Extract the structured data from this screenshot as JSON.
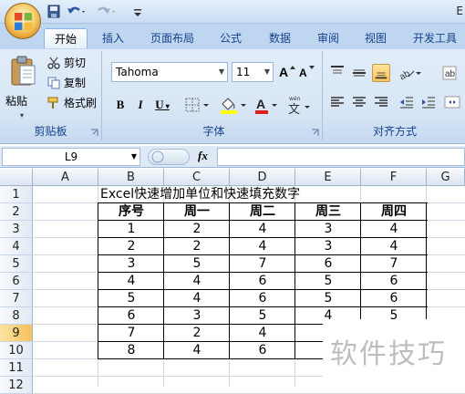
{
  "window": {
    "title_fragment": "E"
  },
  "tabs": [
    "开始",
    "插入",
    "页面布局",
    "公式",
    "数据",
    "审阅",
    "视图",
    "开发工具"
  ],
  "clipboard": {
    "paste": "粘贴",
    "cut": "剪切",
    "copy": "复制",
    "format_painter": "格式刷",
    "group_label": "剪贴板"
  },
  "font": {
    "name": "Tahoma",
    "size": "11",
    "group_label": "字体",
    "phonetic": "文"
  },
  "alignment": {
    "group_label": "对齐方式"
  },
  "formula_bar": {
    "name_box": "L9",
    "fx": "fx",
    "value": ""
  },
  "columns": [
    "A",
    "B",
    "C",
    "D",
    "E",
    "F",
    "G"
  ],
  "rows": [
    "1",
    "2",
    "3",
    "4",
    "5",
    "6",
    "7",
    "8",
    "9",
    "10",
    "11",
    "12"
  ],
  "selected_row": "9",
  "sheet": {
    "title": "Excel快速增加单位和快速填充数字",
    "headers": [
      "序号",
      "周一",
      "周二",
      "周三",
      "周四"
    ],
    "data": [
      [
        "1",
        "2",
        "4",
        "3",
        "4"
      ],
      [
        "2",
        "2",
        "4",
        "3",
        "4"
      ],
      [
        "3",
        "5",
        "7",
        "6",
        "7"
      ],
      [
        "4",
        "4",
        "6",
        "5",
        "6"
      ],
      [
        "5",
        "4",
        "6",
        "5",
        "6"
      ],
      [
        "6",
        "3",
        "5",
        "4",
        "5"
      ],
      [
        "7",
        "2",
        "4",
        "",
        ""
      ],
      [
        "8",
        "4",
        "6",
        "",
        ""
      ]
    ]
  },
  "watermark": "软件技巧",
  "colors": {
    "ribbon": "#d6e5f5",
    "tab_text": "#15428b",
    "selected_row": "#f6c15a"
  }
}
